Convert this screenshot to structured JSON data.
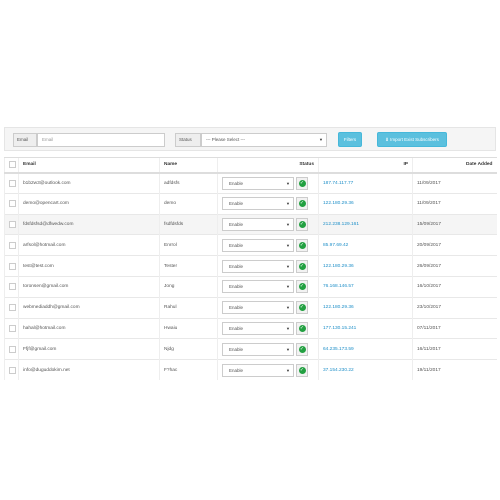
{
  "filters": {
    "email_label": "Email",
    "email_placeholder": "Email",
    "status_label": "Status",
    "status_value": "--- Please Select ---",
    "filter_button": "Filters",
    "import_button": "Import Exist Subscribers"
  },
  "table": {
    "headers": [
      "",
      "Email",
      "Name",
      "Status",
      "IP",
      "Date Added"
    ],
    "rows": [
      {
        "email": "b1b2w3@outlook.com",
        "name": "adfdsfs",
        "status": "Enable",
        "ip": "187.74.117.77",
        "date": "11/09/2017"
      },
      {
        "email": "demo@opencart.com",
        "name": "demo",
        "status": "Enable",
        "ip": "122.180.29.36",
        "date": "11/09/2017"
      },
      {
        "email": "fdsfdsfsd@dfwedw.com",
        "name": "fsdfdsfds",
        "status": "Enable",
        "ip": "212.238.129.161",
        "date": "15/09/2017"
      },
      {
        "email": "arfsol@hotmail.com",
        "name": "Enrrol",
        "status": "Enable",
        "ip": "85.97.69.42",
        "date": "20/09/2017"
      },
      {
        "email": "test@test.com",
        "name": "Tester",
        "status": "Enable",
        "ip": "122.180.29.36",
        "date": "26/09/2017"
      },
      {
        "email": "toronsen@gmail.com",
        "name": "Jong",
        "status": "Enable",
        "ip": "76.168.146.57",
        "date": "16/10/2017"
      },
      {
        "email": "webmediaddh@gmail.com",
        "name": "Rahul",
        "status": "Enable",
        "ip": "122.180.29.36",
        "date": "23/10/2017"
      },
      {
        "email": "hahal@hotmail.com",
        "name": "Hwaiu",
        "status": "Enable",
        "ip": "177.130.15.241",
        "date": "07/11/2017"
      },
      {
        "email": "Ffjf@gmail.com",
        "name": "Njdg",
        "status": "Enable",
        "ip": "64.235.173.59",
        "date": "16/11/2017"
      },
      {
        "email": "info@duguddokim.net",
        "name": "F?hac",
        "status": "Enable",
        "ip": "37.154.230.22",
        "date": "19/11/2017"
      }
    ]
  }
}
